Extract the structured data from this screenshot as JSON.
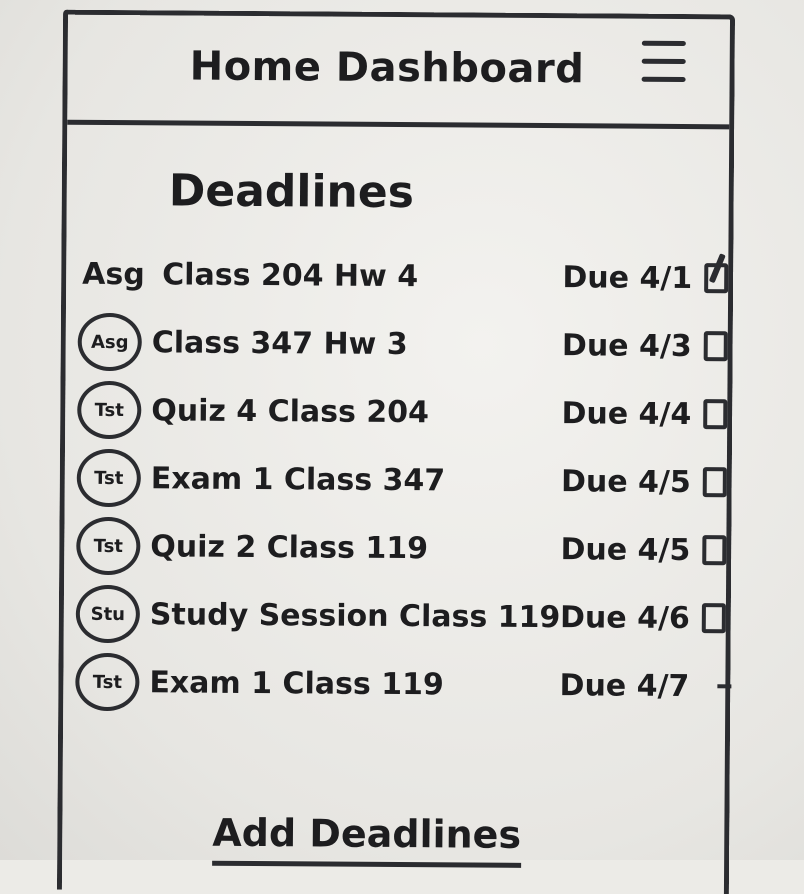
{
  "header": {
    "title": "Home Dashboard"
  },
  "deadlines": {
    "title": "Deadlines",
    "items": [
      {
        "badge": "Asg",
        "badge_circled": false,
        "label": "Class 204 Hw 4",
        "due": "Due 4/1",
        "checked": true
      },
      {
        "badge": "Asg",
        "badge_circled": true,
        "label": "Class 347 Hw 3",
        "due": "Due 4/3",
        "checked": false
      },
      {
        "badge": "Tst",
        "badge_circled": true,
        "label": "Quiz 4 Class 204",
        "due": "Due 4/4",
        "checked": false
      },
      {
        "badge": "Tst",
        "badge_circled": true,
        "label": "Exam 1 Class 347",
        "due": "Due 4/5",
        "checked": false
      },
      {
        "badge": "Tst",
        "badge_circled": true,
        "label": "Quiz 2 Class 119",
        "due": "Due 4/5",
        "checked": false
      },
      {
        "badge": "Stu",
        "badge_circled": true,
        "label": "Study Session Class 119",
        "due": "Due 4/6",
        "checked": false
      },
      {
        "badge": "Tst",
        "badge_circled": true,
        "label": "Exam 1 Class 119",
        "due": "Due 4/7",
        "checked": null
      }
    ]
  },
  "footer": {
    "add_label": "Add Deadlines"
  }
}
